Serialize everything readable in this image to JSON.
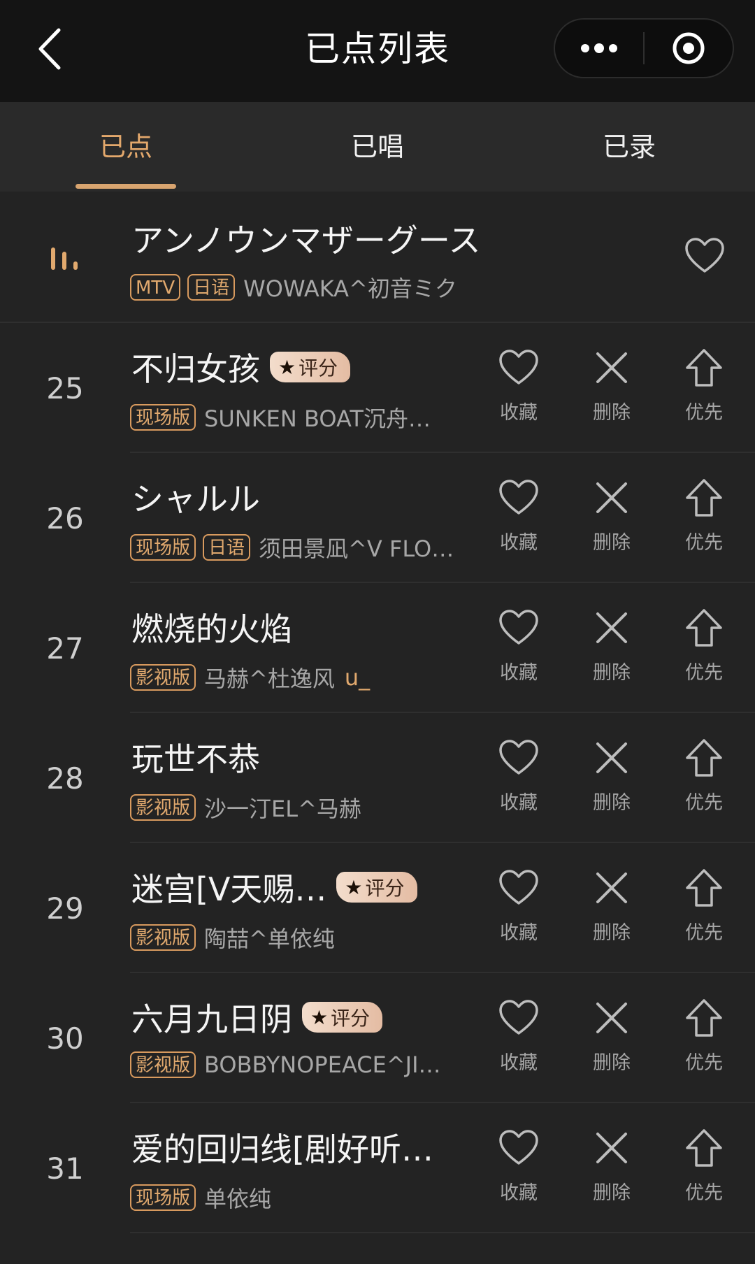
{
  "header": {
    "title": "已点列表"
  },
  "tabs": [
    {
      "label": "已点",
      "active": true
    },
    {
      "label": "已唱",
      "active": false
    },
    {
      "label": "已录",
      "active": false
    }
  ],
  "now_playing": {
    "title": "アンノウンマザーグース",
    "tags": [
      "MTV",
      "日语"
    ],
    "singer": "WOWAKA^初音ミク"
  },
  "action_labels": {
    "favorite": "收藏",
    "delete": "删除",
    "priority": "优先"
  },
  "score_badge_label": "评分",
  "songs": [
    {
      "index": "25",
      "title": "不归女孩",
      "score": true,
      "tags": [
        "现场版"
      ],
      "singer": "SUNKEN BOAT沉舟…",
      "extra": ""
    },
    {
      "index": "26",
      "title": "シャルル",
      "score": false,
      "tags": [
        "现场版",
        "日语"
      ],
      "singer": "须田景凪^V FLO…",
      "extra": ""
    },
    {
      "index": "27",
      "title": "燃烧的火焰",
      "score": false,
      "tags": [
        "影视版"
      ],
      "singer": "马赫^杜逸风",
      "extra": "u_"
    },
    {
      "index": "28",
      "title": "玩世不恭",
      "score": false,
      "tags": [
        "影视版"
      ],
      "singer": "沙一汀EL^马赫",
      "extra": ""
    },
    {
      "index": "29",
      "title": "迷宫[V天赐…",
      "score": true,
      "tags": [
        "影视版"
      ],
      "singer": "陶喆^单依纯",
      "extra": ""
    },
    {
      "index": "30",
      "title": "六月九日阴",
      "score": true,
      "tags": [
        "影视版"
      ],
      "singer": "BOBBYNOPEACE^JI…",
      "extra": ""
    },
    {
      "index": "31",
      "title": "爱的回归线[剧好听…",
      "score": false,
      "tags": [
        "现场版"
      ],
      "singer": "单依纯",
      "extra": ""
    }
  ],
  "colors": {
    "accent": "#e1a96e",
    "background": "#232323",
    "header": "#141414",
    "tabbar": "#2a2a2a"
  }
}
